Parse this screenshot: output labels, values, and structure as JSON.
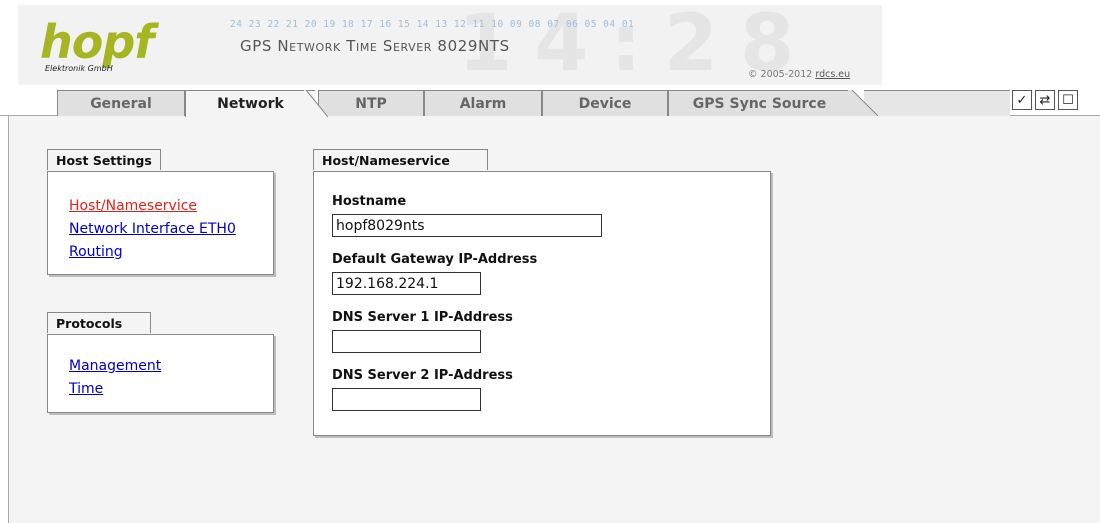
{
  "header": {
    "logo_text": "hopf",
    "logo_sub": "Elektronik   GmbH",
    "digits": "24 23 22 21 20 19 18 17 16 15 14 13 12 11 10 09 08 07 06 05 04 01",
    "product": "GPS Network Time Server 8029NTS",
    "copyright_prefix": "© 2005-2012 ",
    "copyright_link": "rdcs.eu",
    "logo_color": "#a6b522"
  },
  "tabs": [
    {
      "label": "General",
      "active": false
    },
    {
      "label": "Network",
      "active": true
    },
    {
      "label": "NTP",
      "active": false
    },
    {
      "label": "Alarm",
      "active": false
    },
    {
      "label": "Device",
      "active": false
    },
    {
      "label": "GPS Sync Source",
      "active": false
    }
  ],
  "toolbar": {
    "apply_symbol": "✓",
    "reload_symbol": "⇄",
    "save_symbol": "☐"
  },
  "sidebar": {
    "host_settings": {
      "title": "Host Settings",
      "items": [
        {
          "label": "Host/Nameservice",
          "current": true
        },
        {
          "label": "Network Interface ETH0",
          "current": false
        },
        {
          "label": "Routing",
          "current": false
        }
      ]
    },
    "protocols": {
      "title": "Protocols",
      "items": [
        {
          "label": "Management"
        },
        {
          "label": "Time"
        }
      ]
    }
  },
  "panel": {
    "title": "Host/Nameservice",
    "fields": [
      {
        "label": "Hostname",
        "value": ""
      },
      {
        "label": "Default Gateway IP-Address",
        "value": ""
      },
      {
        "label": "DNS Server 1 IP-Address",
        "value": ""
      },
      {
        "label": "DNS Server 2 IP-Address",
        "value": ""
      }
    ],
    "hostname_value": "hopf8029nts",
    "gateway_value": "192.168.224.1",
    "dns1_value": "",
    "dns2_value": ""
  },
  "colors": {
    "link": "#0000cc",
    "current_link": "#e1241b",
    "content_bg": "#f4f4f4"
  }
}
